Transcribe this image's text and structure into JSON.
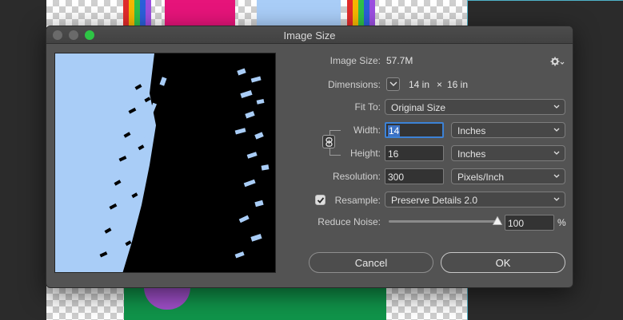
{
  "dialog": {
    "title": "Image Size"
  },
  "summary": {
    "image_size_label": "Image Size:",
    "image_size_value": "57.7M",
    "dimensions_label": "Dimensions:",
    "dimensions_width": "14 in",
    "dimensions_sep": "×",
    "dimensions_height": "16 in"
  },
  "fit_to": {
    "label": "Fit To:",
    "value": "Original Size"
  },
  "width": {
    "label": "Width:",
    "value": "14",
    "unit": "Inches"
  },
  "height": {
    "label": "Height:",
    "value": "16",
    "unit": "Inches"
  },
  "resolution": {
    "label": "Resolution:",
    "value": "300",
    "unit": "Pixels/Inch"
  },
  "resample": {
    "label": "Resample:",
    "checked": true,
    "method": "Preserve Details 2.0"
  },
  "reduce_noise": {
    "label": "Reduce Noise:",
    "value": "100",
    "unit": "%",
    "level_fraction": 1.0
  },
  "buttons": {
    "cancel": "Cancel",
    "ok": "OK"
  },
  "icons": {
    "gear": "gear-icon",
    "link": "link-icon",
    "chevron": "chevron-down-icon",
    "check": "checkmark-icon"
  },
  "colors": {
    "dialog_bg": "#535353",
    "accent_focus": "#3c82d6",
    "zoom_button": "#2ec545",
    "preview_sky": "#a9cdf7",
    "preview_ink": "#000000"
  }
}
